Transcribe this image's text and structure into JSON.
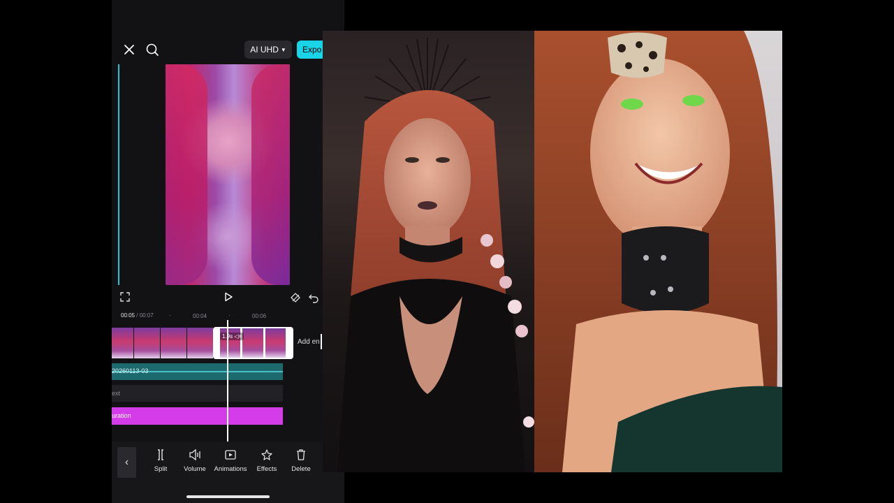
{
  "topbar": {
    "close_icon": "close-icon",
    "search_icon": "search-icon",
    "quality_label": "AI UHD",
    "export_label": "Expo"
  },
  "player": {
    "fullscreen_icon": "expand-icon",
    "play_icon": "play-icon",
    "keyframe_icon": "keyframe-icon",
    "undo_icon": "undo-icon"
  },
  "timeline": {
    "current_time": "00:05",
    "separator": "/",
    "total_time": "00:07",
    "ruler_marks": [
      "00:04",
      "00:06"
    ],
    "selected_clip_duration": "1.9s",
    "add_ending_label": "Add en",
    "audio_track_label": "20260113-03",
    "text_track_label": "ext",
    "effect_track_label": "uration"
  },
  "toolbar": {
    "back_icon": "chevron-left-icon",
    "items": [
      {
        "label": "Split",
        "icon": "split-icon"
      },
      {
        "label": "Volume",
        "icon": "volume-icon"
      },
      {
        "label": "Animations",
        "icon": "animations-icon"
      },
      {
        "label": "Effects",
        "icon": "effects-icon"
      },
      {
        "label": "Delete",
        "icon": "trash-icon"
      }
    ]
  },
  "colors": {
    "accent": "#18d4e6",
    "audio_track": "#1d6a6e",
    "effect_track": "#d43ce9",
    "background": "#121214"
  }
}
